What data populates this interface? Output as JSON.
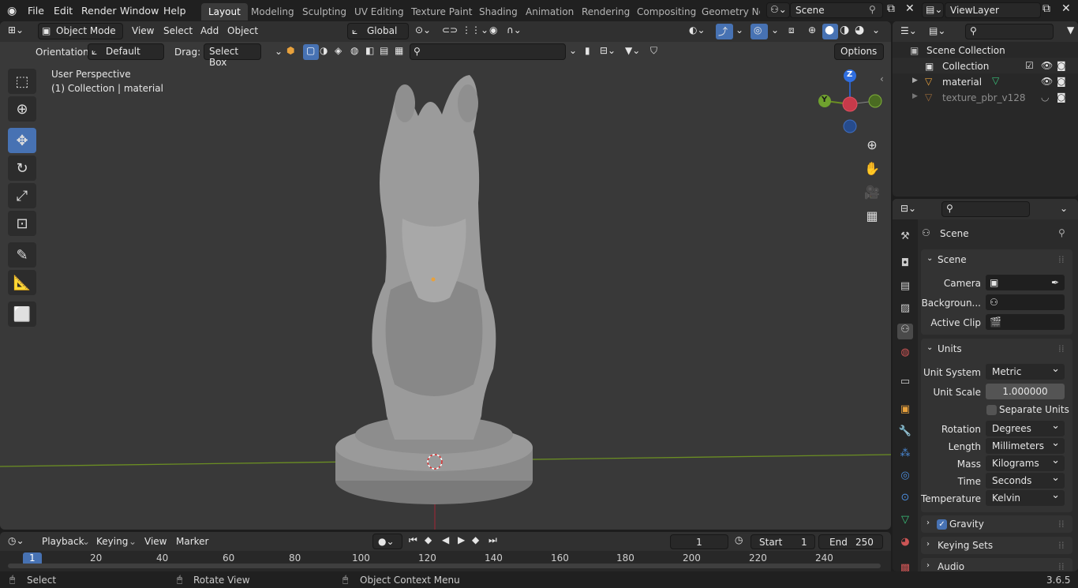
{
  "topbar": {
    "menus": [
      "File",
      "Edit",
      "Render",
      "Window",
      "Help"
    ],
    "workspaces": [
      "Layout",
      "Modeling",
      "Sculpting",
      "UV Editing",
      "Texture Paint",
      "Shading",
      "Animation",
      "Rendering",
      "Compositing",
      "Geometry Noc"
    ],
    "scene": "Scene",
    "view_layer": "ViewLayer"
  },
  "viewport_header": {
    "mode": "Object Mode",
    "menus": [
      "View",
      "Select",
      "Add",
      "Object"
    ],
    "transform_orientation": "Global",
    "orientation_label": "Orientation:",
    "orientation_value": "Default",
    "drag_label": "Drag:",
    "drag_value": "Select Box",
    "options": "Options"
  },
  "viewport": {
    "perspective": "User Perspective",
    "context": "(1) Collection | material",
    "gizmo_axes": {
      "z": "Z",
      "y": "Y"
    },
    "colors": {
      "background": "#393939",
      "x_axis": "#8b2a36",
      "y_axis": "#6b8e23",
      "model": "#8a8a8a"
    }
  },
  "outliner": {
    "root": "Scene Collection",
    "items": [
      {
        "label": "Collection",
        "type": "collection"
      },
      {
        "label": "material",
        "type": "object"
      },
      {
        "label": "texture_pbr_v128",
        "type": "object-hidden"
      }
    ]
  },
  "properties": {
    "context_title": "Scene",
    "scene_panel": {
      "title": "Scene",
      "camera_label": "Camera",
      "background_label": "Backgroun...",
      "active_clip_label": "Active Clip"
    },
    "units_panel": {
      "title": "Units",
      "unit_system_label": "Unit System",
      "unit_system": "Metric",
      "unit_scale_label": "Unit Scale",
      "unit_scale": "1.000000",
      "separate_units": "Separate Units",
      "rotation_label": "Rotation",
      "rotation": "Degrees",
      "length_label": "Length",
      "length": "Millimeters",
      "mass_label": "Mass",
      "mass": "Kilograms",
      "time_label": "Time",
      "time": "Seconds",
      "temperature_label": "Temperature",
      "temperature": "Kelvin"
    },
    "gravity": "Gravity",
    "keying_sets": "Keying Sets",
    "audio": "Audio"
  },
  "timeline": {
    "menus": [
      "Playback",
      "Keying",
      "View",
      "Marker"
    ],
    "current_frame": "1",
    "start_label": "Start",
    "start": "1",
    "end_label": "End",
    "end": "250",
    "ticks": [
      "1",
      "20",
      "40",
      "60",
      "80",
      "100",
      "120",
      "140",
      "160",
      "180",
      "200",
      "220",
      "240"
    ]
  },
  "statusbar": {
    "select": "Select",
    "rotate": "Rotate View",
    "context_menu": "Object Context Menu",
    "version": "3.6.5"
  }
}
